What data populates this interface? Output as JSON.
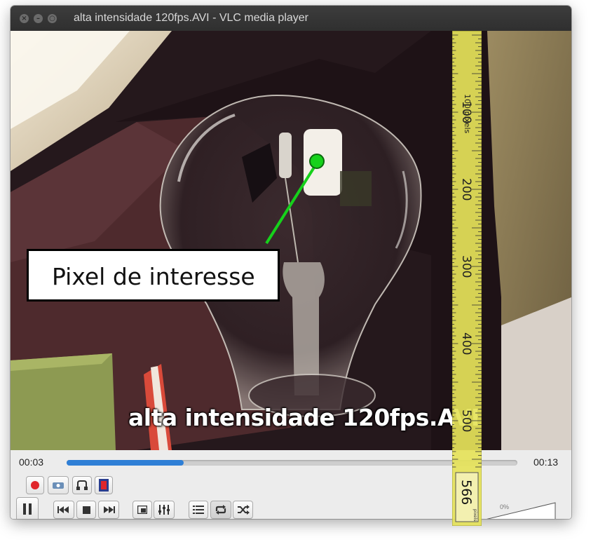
{
  "window": {
    "title": "alta intensidade 120fps.AVI - VLC media player"
  },
  "video": {
    "subtitle": "alta intensidade 120fps.AVI",
    "annotation_label": "Pixel de interesse"
  },
  "playback": {
    "elapsed": "00:03",
    "total": "00:13",
    "progress_fraction": 0.26,
    "volume_label": "0%"
  },
  "ruler": {
    "rotated_label": "100 pixels",
    "ticks": [
      "100",
      "200",
      "300",
      "400",
      "500"
    ],
    "end_value": "566",
    "end_unit": "pixels"
  },
  "icons": {
    "record": "record-icon",
    "snapshot": "camera-icon",
    "loop_ab": "loop-ab-icon",
    "frame_step": "film-frame-icon",
    "pause": "pause-icon",
    "previous": "previous-icon",
    "stop": "stop-icon",
    "next": "next-icon",
    "fullscreen": "fullscreen-icon",
    "extended": "equalizer-icon",
    "playlist": "playlist-icon",
    "loop": "loop-icon",
    "shuffle": "shuffle-icon"
  },
  "colors": {
    "accent": "#2f7fd6",
    "record": "#e0262b",
    "marker": "#16d11b",
    "ruler": "#e6e35a"
  }
}
